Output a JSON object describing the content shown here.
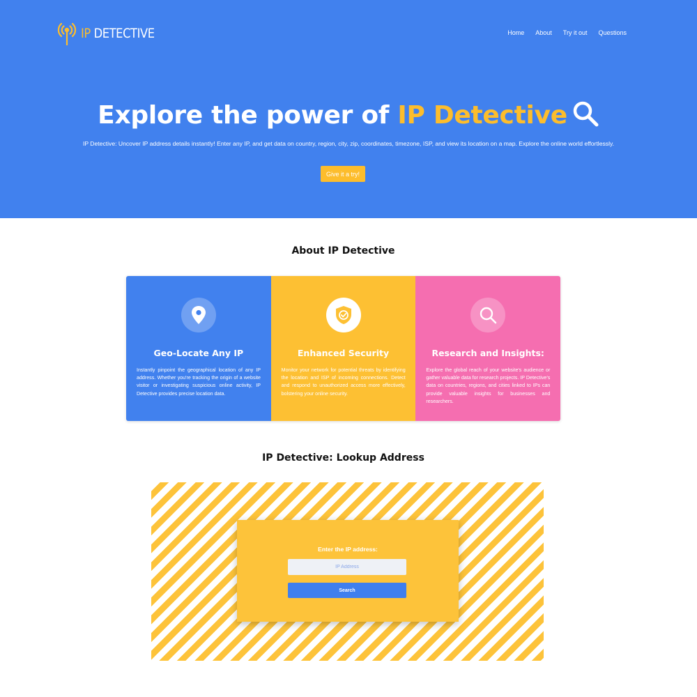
{
  "header": {
    "logo_ip": "IP",
    "logo_rest": "DETECTIVE",
    "logo_icon": "broadcast-antenna-icon",
    "nav": [
      {
        "label": "Home"
      },
      {
        "label": "About"
      },
      {
        "label": "Try it out"
      },
      {
        "label": "Questions"
      }
    ]
  },
  "hero": {
    "title_start": "Explore the power of",
    "title_accent": "IP Detective",
    "title_icon": "magnifier-icon",
    "description": "IP Detective: Uncover IP address details instantly! Enter any IP, and get data on country, region, city, zip, coordinates, timezone, ISP, and view its location on a map. Explore the online world effortlessly.",
    "cta_label": "Give it a try!"
  },
  "about": {
    "title": "About IP Detective",
    "cards": [
      {
        "icon": "location-pin-icon",
        "title": "Geo-Locate Any IP",
        "text": "Instantly pinpoint the geographical location of any IP address. Whether you're tracking the origin of a website visitor or investigating suspicious online activity, IP Detective provides precise location data.",
        "color": "#4181ee"
      },
      {
        "icon": "security-shield-icon",
        "title": "Enhanced Security",
        "text": "Monitor your network for potential threats by identifying the location and ISP of incoming connections. Detect and respond to unauthorized access more effectively, bolstering your online security.",
        "color": "#fdc033"
      },
      {
        "icon": "search-icon",
        "title": "Research and Insights:",
        "text": "Explore the global reach of your website's audience or gather valuable data for research projects. IP Detective's data on countries, regions, and cities linked to IPs can provide valuable insights for businesses and researchers.",
        "color": "#f56eb0"
      }
    ]
  },
  "lookup": {
    "title": "IP Detective: Lookup Address",
    "label": "Enter the IP address:",
    "placeholder": "IP Address",
    "button_label": "Search"
  },
  "colors": {
    "primary_blue": "#4181ee",
    "accent_yellow": "#fdbd2c",
    "pink": "#f56eb0"
  }
}
